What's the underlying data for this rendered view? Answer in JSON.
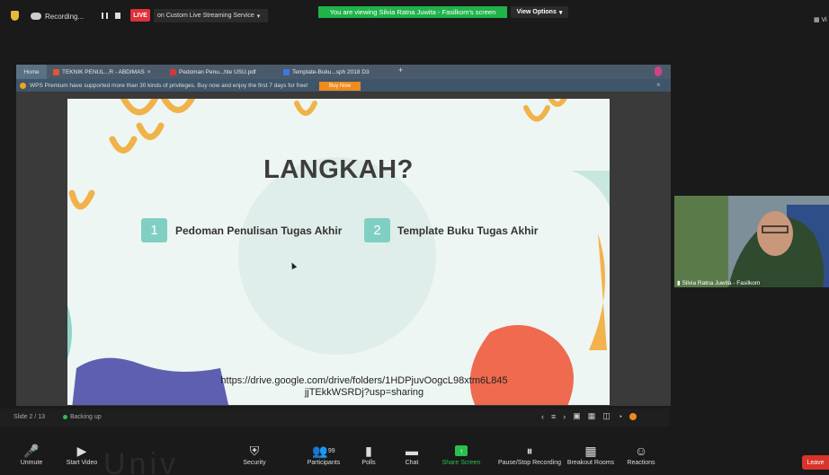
{
  "top_bar": {
    "recording_label": "Recording...",
    "live_label": "LIVE",
    "stream_service": "on Custom Live Streaming Service",
    "viewing_banner": "You are viewing Silvia Ratna Juwita - Fasilkom's screen",
    "view_options": "View Options",
    "view_right": "Vi"
  },
  "wps": {
    "tabs": [
      {
        "label": "Home"
      },
      {
        "label": "TEKNIK PENUL...R - ABDIMAS",
        "color": "#e0543a"
      },
      {
        "label": "Pedoman Penu...hte USU.pdf",
        "color": "#d03a3a"
      },
      {
        "label": "Template-Buku...sph 2018 D3",
        "color": "#3a7ae0"
      }
    ],
    "plus": "+",
    "banner_text": "WPS Premium have supported more than 30 kinds of privileges. Buy now and enjoy the first 7 days for free!",
    "buy_now": "Buy Now",
    "banner_close": "×",
    "slide_counter": "Slide 2 / 13",
    "backing_up": "Backing up"
  },
  "slide": {
    "title": "LANGKAH?",
    "items": [
      {
        "num": "1",
        "label": "Pedoman Penulisan Tugas Akhir"
      },
      {
        "num": "2",
        "label": "Template  Buku Tugas Akhir"
      }
    ],
    "link_line1": "https://drive.google.com/drive/folders/1HDPjuvOogcL98xtm6L845",
    "link_line2": "jjTEkkWSRDj?usp=sharing"
  },
  "video": {
    "participant_name": "Silvia Ratna Juwita - Fasilkom"
  },
  "toolbar": {
    "unmute": "Unmute",
    "start_video": "Start Video",
    "security": "Security",
    "participants": "Participants",
    "participant_count": "99",
    "polls": "Polls",
    "chat": "Chat",
    "share_screen": "Share Screen",
    "pause_stop_recording": "Pause/Stop Recording",
    "breakout_rooms": "Breakout Rooms",
    "reactions": "Reactions",
    "leave": "Leave"
  },
  "watermark": "Univ"
}
